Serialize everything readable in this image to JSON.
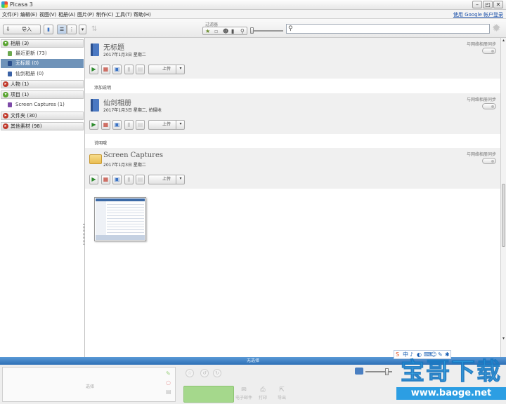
{
  "window": {
    "title": "Picasa 3",
    "minimize": "–",
    "restore": "◰",
    "close": "✕"
  },
  "menu": {
    "items": [
      "文件(F)",
      "编辑(E)",
      "视图(V)",
      "相册(A)",
      "图片(P)",
      "制作(C)",
      "工具(T)",
      "帮助(H)"
    ],
    "signin": "使用 Google 帐户登录"
  },
  "toolbar": {
    "import_label": "导入",
    "filter_label": "过滤器",
    "search_placeholder": ""
  },
  "sidebar": {
    "albums_header": "相册 (3)",
    "albums": [
      {
        "label": "最近更新 (73)"
      },
      {
        "label": "无标题 (0)",
        "selected": true
      },
      {
        "label": "仙剑相册 (0)"
      }
    ],
    "people_header": "人物 (1)",
    "projects_header": "项目 (1)",
    "projects": [
      {
        "label": "Screen Captures (1)"
      }
    ],
    "folders_header": "文件夹 (30)",
    "other_header": "其他素材 (98)"
  },
  "albums": [
    {
      "title": "无标题",
      "meta": "2017年1月3日 星期二",
      "sync": "与网络相册同步",
      "caption": "添加说明",
      "upload": "上传",
      "icon": "album-book-icon"
    },
    {
      "title": "仙剑相册",
      "meta": "2017年1月3日 星期二, 拍摄地",
      "sync": "与网络相册同步",
      "caption": "说明哦",
      "upload": "上传",
      "icon": "album-book-icon"
    },
    {
      "title": "Screen Captures",
      "meta": "2017年1月3日 星期二",
      "sync": "与网络相册同步",
      "caption": "",
      "upload": "上传",
      "icon": "folder-icon"
    }
  ],
  "tray": {
    "bar_label": "无选择",
    "selection_placeholder": "选择",
    "share_label": "",
    "actions": [
      {
        "label": "电子邮件",
        "icon": "email-icon"
      },
      {
        "label": "打印",
        "icon": "print-icon"
      },
      {
        "label": "导出",
        "icon": "export-icon"
      }
    ]
  },
  "ime": {
    "items": [
      "S",
      "中",
      "♪",
      "◐",
      "⌨",
      "☺",
      "✎",
      "✱"
    ]
  },
  "watermark": {
    "text": "宝哥下载",
    "url": "www.baoge.net"
  },
  "colors": {
    "selection": "#6f93b9",
    "tray_bar": "#2d6fb6",
    "share_button": "#a5d88c",
    "signin_link": "#1a4fa8"
  }
}
